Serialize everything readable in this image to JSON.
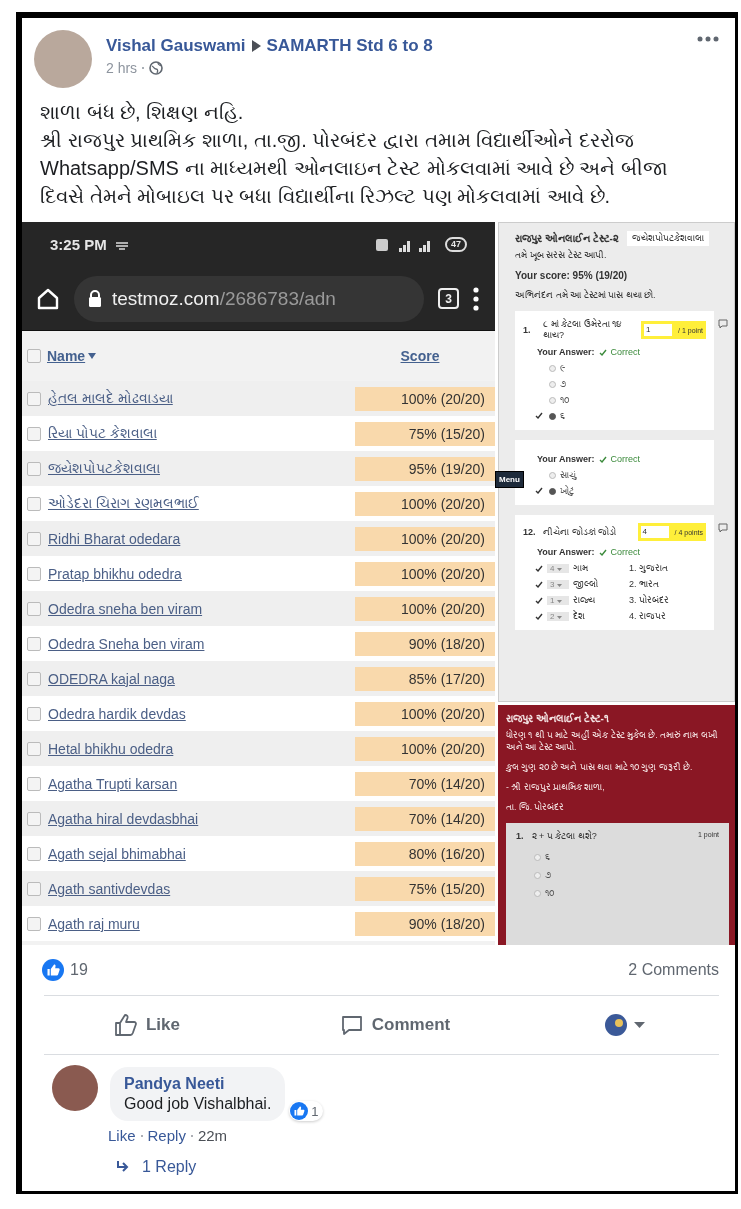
{
  "post": {
    "author": "Vishal Gauswami",
    "group": "SAMARTH Std 6 to 8",
    "time": "2 hrs",
    "paragraphs": [
      "શાળા બંધ છે, શિક્ષણ નહિ.",
      "શ્રી રાજપુર પ્રાથમિક શાળા, તા.જી. પોરબંદર દ્વારા તમામ વિદ્યાર્થીઓને દરરોજ Whatsapp/SMS ના માધ્યમથી ઓનલાઇન ટેસ્ટ મોકલવામાં આવે છે અને બીજા દિવસે તેમને મોબાઇલ પર બધા વિદ્યાર્થીના રિઝલ્ટ પણ મોકલવામાં આવે છે."
    ]
  },
  "phone_screenshot": {
    "status_time": "3:25 PM",
    "battery": "47",
    "url_domain": "testmoz.com",
    "url_path": "/2686783/adn",
    "tab_count": "3",
    "all_checked": false,
    "columns": [
      "Name",
      "Score"
    ],
    "rows": [
      {
        "name": "હેતલ માલદે મોઢવાડયા",
        "score": "100% (20/20)",
        "checked": false
      },
      {
        "name": "રિયા પોપટ કેશવાલા",
        "score": "75% (15/20)",
        "checked": false
      },
      {
        "name": "જયેશપોપટકેશવાલા",
        "score": "95% (19/20)",
        "checked": false
      },
      {
        "name": "ઓડેદરા ચિરાગ રણમલભાઈ",
        "score": "100% (20/20)",
        "checked": false
      },
      {
        "name": "Ridhi Bharat odedara",
        "score": "100% (20/20)",
        "checked": false
      },
      {
        "name": "Pratap bhikhu odedra",
        "score": "100% (20/20)",
        "checked": false
      },
      {
        "name": "Odedra sneha ben viram",
        "score": "100% (20/20)",
        "checked": false
      },
      {
        "name": "Odedra Sneha ben viram",
        "score": "90% (18/20)",
        "checked": false
      },
      {
        "name": "ODEDRA kajal naga",
        "score": "85% (17/20)",
        "checked": false
      },
      {
        "name": "Odedra hardik devdas",
        "score": "100% (20/20)",
        "checked": false
      },
      {
        "name": "Hetal bhikhu odedra",
        "score": "100% (20/20)",
        "checked": false
      },
      {
        "name": "Agatha Trupti karsan",
        "score": "70% (14/20)",
        "checked": false
      },
      {
        "name": "Agatha hiral devdasbhai",
        "score": "70% (14/20)",
        "checked": false
      },
      {
        "name": "Agath sejal bhimabhai",
        "score": "80% (16/20)",
        "checked": false
      },
      {
        "name": "Agath santivdevdas",
        "score": "75% (15/20)",
        "checked": false
      },
      {
        "name": "Agath raj muru",
        "score": "90% (18/20)",
        "checked": false
      }
    ]
  },
  "result_screenshot": {
    "title": "રાજપુર ઓનલાઈન ટેસ્ટ-૨",
    "student": "જયેશપોપટકેશવાલા",
    "message": "તમે ખૂબ સરસ ટેસ્ટ આપી.",
    "score": "Your score: 95% (19/20)",
    "congrats": "અભિનંદન તમે આ ટેસ્ટમાં પાસ થયા છો.",
    "menu": "Menu",
    "questions": [
      {
        "kind": "choice",
        "number": "1.",
        "text": "૮ માં કેટલા ઉમેરતા ૧૪ થાય?",
        "answer_value": "1",
        "points": "/ 1 point",
        "answer_label": "Your Answer:",
        "verdict": "Correct",
        "options": [
          {
            "label": "૯",
            "selected": false
          },
          {
            "label": "૭",
            "selected": false
          },
          {
            "label": "૧૦",
            "selected": false
          },
          {
            "label": "૬",
            "selected": true
          }
        ]
      },
      {
        "kind": "choice",
        "answer_label": "Your Answer:",
        "verdict": "Correct",
        "options": [
          {
            "label": "સાચું",
            "selected": false
          },
          {
            "label": "ખોટું",
            "selected": true
          }
        ]
      },
      {
        "kind": "match",
        "number": "12.",
        "text": "નીચેના જોડકાં જોડો",
        "answer_value": "4",
        "points": "/ 4 points",
        "answer_label": "Your Answer:",
        "verdict": "Correct",
        "pairs": [
          {
            "choice": "4",
            "left": "ગામ",
            "right": "1. ગુજરાત"
          },
          {
            "choice": "3",
            "left": "જીલ્લો",
            "right": "2. ભારત"
          },
          {
            "choice": "1",
            "left": "રાજ્ય",
            "right": "3. પોરબંદર"
          },
          {
            "choice": "2",
            "left": "દેશ",
            "right": "4. રાજપર"
          }
        ]
      }
    ]
  },
  "test_screenshot": {
    "title": "રાજપુર ઓનલાઈન ટેસ્ટ-૧",
    "lines": [
      "ધોરણ ૧ થી ૫ માટે અહીં એક ટેસ્ટ મુકેલ છે. તમારું નામ લખી અને આ ટેસ્ટ આપો.",
      "કુલ ગુણ ૨૦ છે અને પાસ થવા માટે ૧૦ ગુણ જરૂરી છે.",
      "- શ્રી રાજપુર પ્રાથમિક શાળા,",
      "તા. જિ. પોરબંદર"
    ],
    "question": {
      "number": "1.",
      "text": "૨ + ૫ કેટલા થશે?",
      "points": "1 point",
      "options": [
        {
          "label": "૬",
          "selected": false
        },
        {
          "label": "૭",
          "selected": false
        },
        {
          "label": "૧૦",
          "selected": false
        }
      ]
    }
  },
  "footer": {
    "like_count": "19",
    "comments_count": "2 Comments",
    "actions": [
      "Like",
      "Comment"
    ]
  },
  "comment": {
    "author": "Pandya Neeti",
    "text": "Good job Vishalbhai.",
    "reaction_count": "1",
    "links": [
      "Like",
      "Reply"
    ],
    "time": "22m",
    "replies": "1 Reply"
  }
}
